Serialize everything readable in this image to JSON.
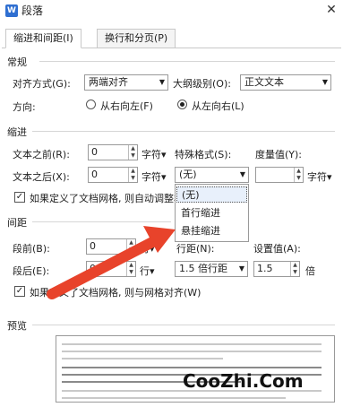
{
  "window": {
    "title": "段落",
    "app_icon": "W",
    "close": "✕"
  },
  "tabs": [
    {
      "label": "缩进和间距(I)",
      "active": true
    },
    {
      "label": "换行和分页(P)",
      "active": false
    }
  ],
  "general": {
    "heading": "常规",
    "align_label": "对齐方式(G):",
    "align_value": "两端对齐",
    "outline_label": "大纲级别(O):",
    "outline_value": "正文文本",
    "direction_label": "方向:",
    "rtl_label": "从右向左(F)",
    "ltr_label": "从左向右(L)",
    "selected_direction": "ltr"
  },
  "indent": {
    "heading": "缩进",
    "before_label": "文本之前(R):",
    "before_value": "0",
    "before_unit": "字符▾",
    "after_label": "文本之后(X):",
    "after_value": "0",
    "after_unit": "字符▾",
    "special_label": "特殊格式(S):",
    "special_value": "(无)",
    "measure_label": "度量值(Y):",
    "measure_value": "",
    "measure_unit": "字符▾",
    "grid_check_label": "如果定义了文档网格, 则自动调整右缩进(D)",
    "grid_checked": true
  },
  "special_dropdown": {
    "options": [
      "(无)",
      "首行缩进",
      "悬挂缩进"
    ],
    "highlighted": "(无)"
  },
  "spacing": {
    "heading": "间距",
    "before_label": "段前(B):",
    "before_value": "0",
    "before_unit": "行▾",
    "after_label": "段后(E):",
    "after_value": "0",
    "after_unit": "行▾",
    "line_label": "行距(N):",
    "line_value": "1.5 倍行距",
    "setting_label": "设置值(A):",
    "setting_value": "1.5",
    "setting_unit": "倍",
    "grid_check_label": "如果定义了文档网格, 则与网格对齐(W)",
    "grid_checked": true
  },
  "preview": {
    "heading": "预览"
  },
  "watermark": "CooZhi.Com",
  "colors": {
    "arrow": "#e8432b",
    "accent": "#2f6fd1"
  }
}
